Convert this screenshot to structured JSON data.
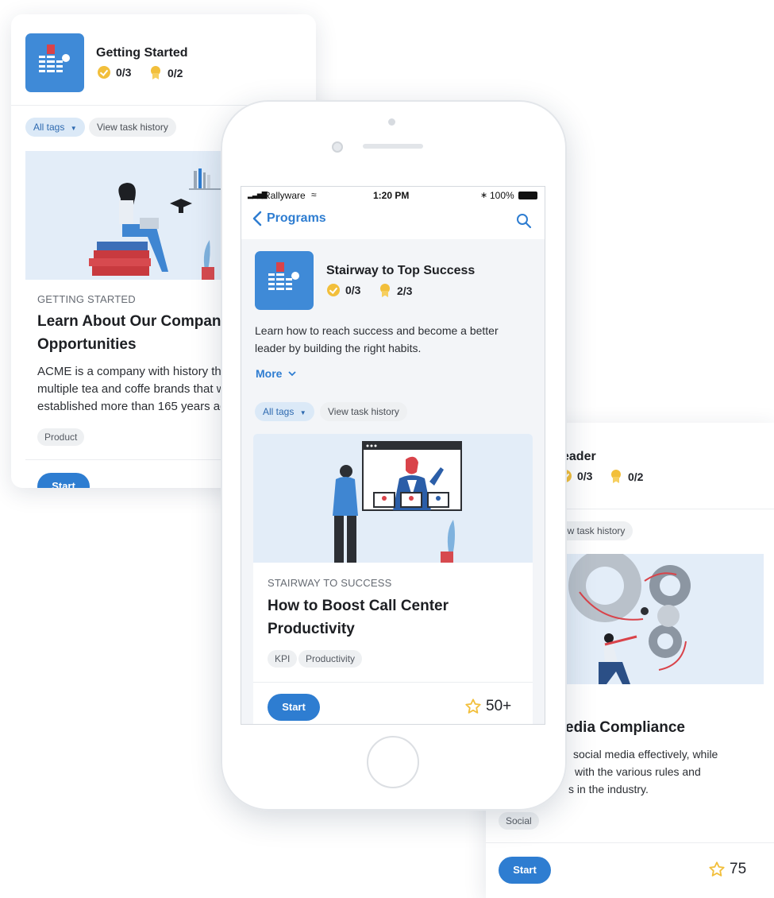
{
  "left_card": {
    "program_title": "Getting Started",
    "coins": "0/3",
    "awards": "0/2",
    "all_tags": "All tags",
    "view_history": "View task history",
    "course_category": "GETTING STARTED",
    "course_title": "Learn About Our Company Opportunities",
    "course_description": "ACME is a company with history that owns multiple tea and coffe brands that were established more than 165 years ago.",
    "tag": "Product",
    "start": "Start"
  },
  "phone": {
    "status": {
      "carrier": "Rallyware",
      "time": "1:20 PM",
      "battery": "100%"
    },
    "nav": {
      "back_label": "Programs"
    },
    "program": {
      "title": "Stairway to Top Success",
      "coins": "0/3",
      "awards": "2/3",
      "description": "Learn how to reach success and become a better leader by building the right habits.",
      "more": "More"
    },
    "filters": {
      "all_tags": "All tags",
      "view_history": "View task history"
    },
    "course": {
      "category": "STAIRWAY TO SUCCESS",
      "title": "How to Boost Call Center Productivity",
      "tags": [
        "KPI",
        "Productivity"
      ],
      "start": "Start",
      "points": "50+"
    }
  },
  "right_card": {
    "program_title": "eader",
    "coins": "0/3",
    "awards": "0/2",
    "view_history": "ew task history",
    "course_title": "edia Compliance",
    "course_description_lines": [
      "social media effectively, while",
      "with the various rules and",
      "s in the industry."
    ],
    "tag": "Social",
    "start": "Start",
    "points": "75"
  },
  "colors": {
    "accent": "#2e7dd1",
    "icon_bg": "#3f8ad7",
    "gold": "#f2bf3b",
    "illustration_bg": "#e3edf8"
  }
}
